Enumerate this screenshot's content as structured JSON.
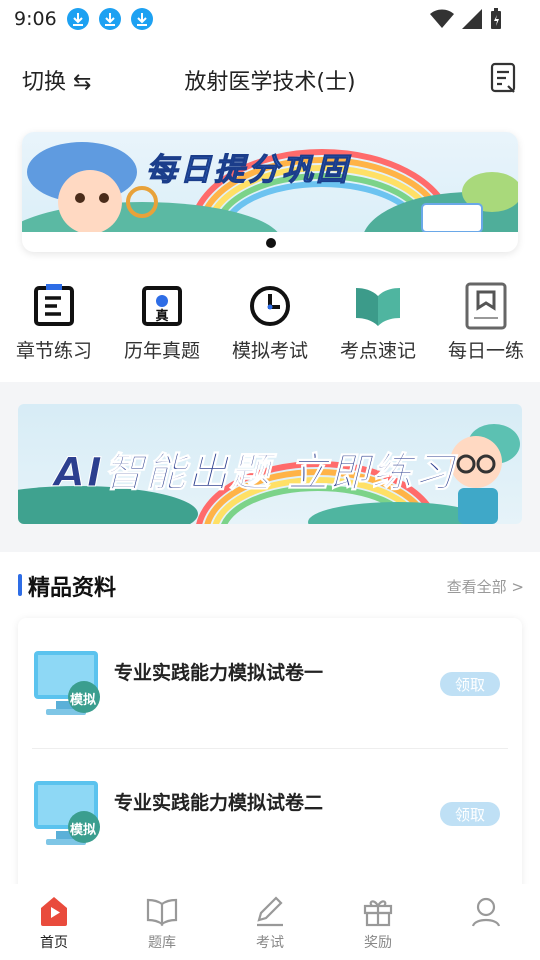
{
  "status": {
    "time": "9:06"
  },
  "header": {
    "switch_label": "切换 ⇆",
    "title": "放射医学技术(士)"
  },
  "banner": {
    "title": "每日提分巩固"
  },
  "quick": [
    {
      "label": "章节练习",
      "icon": "chapter-icon"
    },
    {
      "label": "历年真题",
      "icon": "real-exam-icon"
    },
    {
      "label": "模拟考试",
      "icon": "clock-icon"
    },
    {
      "label": "考点速记",
      "icon": "open-book-icon"
    },
    {
      "label": "每日一练",
      "icon": "bookmark-book-icon"
    }
  ],
  "ai_banner": {
    "title": "AI智能出题 立即练习"
  },
  "section": {
    "title": "精品资料",
    "more": "查看全部 >",
    "items": [
      {
        "title": "专业实践能力模拟试卷一",
        "badge": "模拟",
        "action": "领取"
      },
      {
        "title": "专业实践能力模拟试卷二",
        "badge": "模拟",
        "action": "领取"
      }
    ]
  },
  "tabs": [
    {
      "label": "首页",
      "icon": "home-play-icon"
    },
    {
      "label": "题库",
      "icon": "book-icon"
    },
    {
      "label": "考试",
      "icon": "pencil-icon"
    },
    {
      "label": "奖励",
      "icon": "gift-icon"
    },
    {
      "label": "",
      "icon": "user-icon"
    }
  ],
  "colors": {
    "accent": "#e94b3c",
    "blue": "#2e6de6",
    "pill": "#bfe0f5"
  }
}
